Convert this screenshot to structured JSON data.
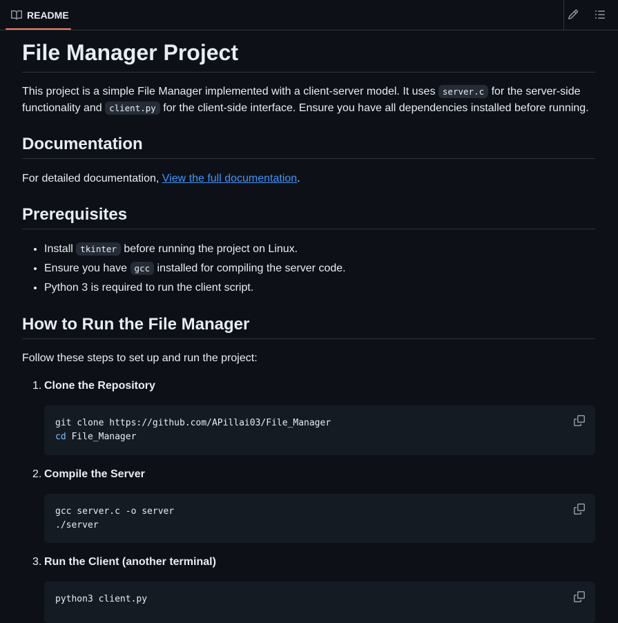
{
  "header": {
    "tab_label": "README",
    "tab_icon": "book-icon",
    "edit_icon": "pencil-icon",
    "outline_icon": "list-icon"
  },
  "readme": {
    "title": "File Manager Project",
    "intro": {
      "part1": "This project is a simple File Manager implemented with a client-server model. It uses ",
      "code1": "server.c",
      "part2": " for the server-side",
      "part3": "functionality and ",
      "code2": "client.py",
      "part4": " for the client-side interface. Ensure you have all dependencies installed before running."
    },
    "documentation": {
      "heading": "Documentation",
      "text": "For detailed documentation, ",
      "link": "View the full documentation",
      "after": "."
    },
    "prerequisites": {
      "heading": "Prerequisites",
      "items": [
        {
          "before": "Install ",
          "code": "tkinter",
          "after": " before running the project on Linux."
        },
        {
          "before": "Ensure you have ",
          "code": "gcc",
          "after": " installed for compiling the server code."
        },
        {
          "text": "Python 3 is required to run the client script."
        }
      ]
    },
    "howto": {
      "heading": "How to Run the File Manager",
      "intro": "Follow these steps to set up and run the project:",
      "steps": [
        {
          "num": "1.",
          "title": "Clone the Repository",
          "lines": [
            {
              "kw": "",
              "text": "git clone https://github.com/APillai03/File_Manager"
            },
            {
              "kw": "cd",
              "text": " File_Manager"
            }
          ]
        },
        {
          "num": "2.",
          "title": "Compile the Server",
          "lines": [
            {
              "kw": "",
              "text": "gcc server.c -o server"
            },
            {
              "kw": "",
              "text": "./server"
            }
          ]
        },
        {
          "num": "3.",
          "title": "Run the Client (another terminal)",
          "lines": [
            {
              "kw": "",
              "text": "python3 client.py"
            }
          ]
        }
      ]
    }
  },
  "colors": {
    "background": "#0d1117",
    "text": "#e6edf3",
    "link": "#4493f8",
    "accent": "#f78166",
    "code_bg": "#151b23"
  }
}
